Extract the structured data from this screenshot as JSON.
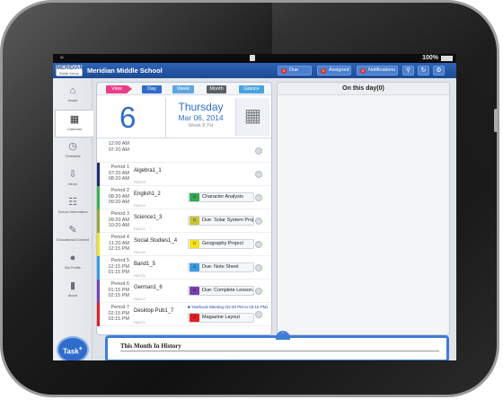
{
  "status": {
    "battery": "100%"
  },
  "app": {
    "logo_line1": "MERIDIAN",
    "logo_line2": "Middle School",
    "school_name": "Meridian Middle School",
    "badges": [
      {
        "label": "Due",
        "count": "0"
      },
      {
        "label": "Assigned",
        "count": "0"
      },
      {
        "label": "Notifications",
        "count": "0"
      }
    ]
  },
  "sidebar": {
    "items": [
      {
        "label": "Home",
        "icon": "home-icon"
      },
      {
        "label": "Calendar",
        "icon": "calendar-icon"
      },
      {
        "label": "Timetable",
        "icon": "clock-icon"
      },
      {
        "label": "Inbox",
        "icon": "inbox-icon"
      },
      {
        "label": "School Information",
        "icon": "school-icon"
      },
      {
        "label": "Educational Content",
        "icon": "pencil-icon"
      },
      {
        "label": "My Profile",
        "icon": "user-icon"
      },
      {
        "label": "About",
        "icon": "book-icon"
      }
    ],
    "task_label": "Task",
    "task_plus": "+"
  },
  "tabs": {
    "view": "View",
    "day": "Day",
    "week": "Week",
    "month": "Month",
    "glance": "Glance"
  },
  "date": {
    "day_number": "6",
    "weekday": "Thursday",
    "date": "Mar 06, 2014",
    "week": "Week 8,TH"
  },
  "schedule": [
    {
      "period": "",
      "start": "12:00 AM",
      "end": "07:20 AM",
      "class": "",
      "room": "",
      "color": "#ffffff",
      "item": "",
      "item_color": ""
    },
    {
      "period": "Period 1",
      "start": "07:20 AM",
      "end": "08:20 AM",
      "class": "Algebra1_1",
      "room": "RM209",
      "color": "#1f2a6b",
      "item": "",
      "item_color": ""
    },
    {
      "period": "Period 2",
      "start": "08:20 AM",
      "end": "09:20 AM",
      "class": "English1_2",
      "room": "RM209",
      "color": "#3ab54a",
      "item": "Character Analysis",
      "item_color": "#34a853"
    },
    {
      "period": "Period 3",
      "start": "09:20 AM",
      "end": "10:20 AM",
      "class": "Science1_3",
      "room": "RM211",
      "color": "#9aa83a",
      "item": "Due: Solar System Proj...",
      "item_color": "#c7c33b"
    },
    {
      "period": "Period 4",
      "start": "11:20 AM",
      "end": "12:15 PM",
      "class": "Social Studies1_4",
      "room": "RM206",
      "color": "#f2e21e",
      "item": "Geography Project",
      "item_color": "#f2e21e"
    },
    {
      "period": "Period 5",
      "start": "12:15 PM",
      "end": "01:15 PM",
      "class": "Band1_5",
      "room": "RM220",
      "color": "#3a9be0",
      "item": "Due: Note Sheet",
      "item_color": "#3a9be0"
    },
    {
      "period": "Period 6",
      "start": "01:15 PM",
      "end": "02:15 PM",
      "class": "German1_6",
      "room": "RM212",
      "color": "#7a3fb0",
      "item": "Due: Complete Lesson...",
      "item_color": "#7a3fb0"
    },
    {
      "period": "Period 7",
      "start": "02:15 PM",
      "end": "03:15 PM",
      "class": "Desktop Pub1_7",
      "room": "RM220",
      "color": "#e02020",
      "item": "Magazine Layout",
      "item_color": "#e02020",
      "meeting": "Yearbook Meeting (02:20 PM to 03:15 PM)"
    }
  ],
  "on_this_day": {
    "title": "On this day(0)"
  },
  "history": {
    "title": "This Month In History"
  }
}
